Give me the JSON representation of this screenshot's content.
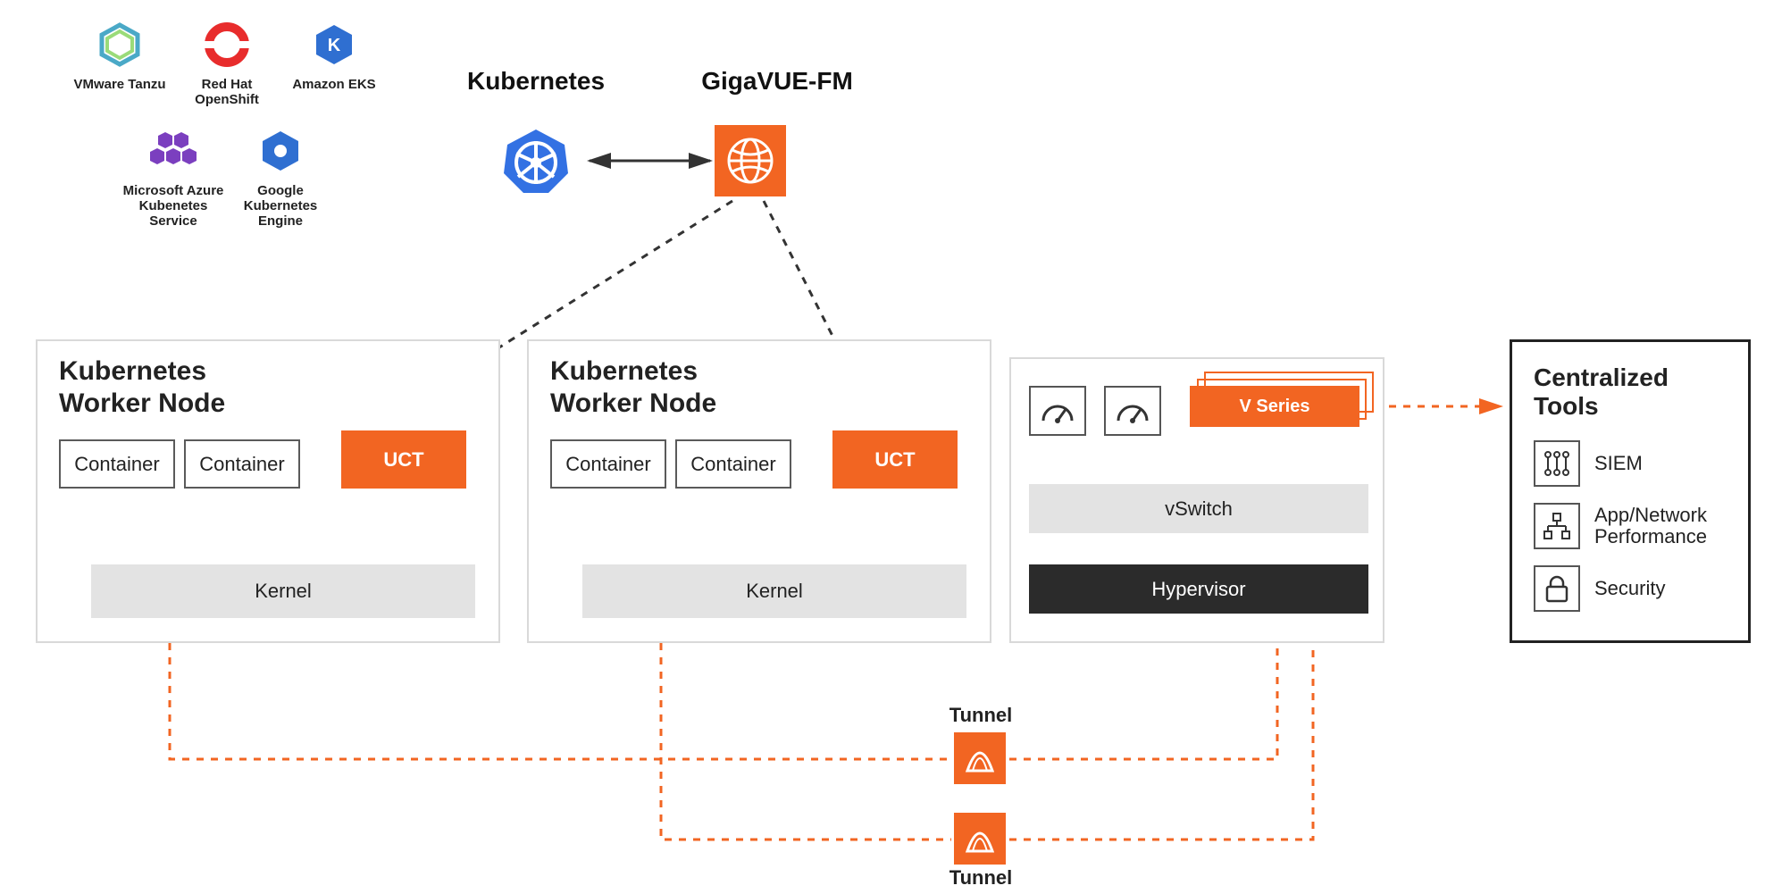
{
  "providers": [
    {
      "name": "VMware\nTanzu",
      "icon": "tanzu-icon",
      "color": "#5fb0c9"
    },
    {
      "name": "Red Hat\nOpenShift",
      "icon": "openshift-icon",
      "color": "#e82c2c"
    },
    {
      "name": "Amazon\nEKS",
      "icon": "eks-icon",
      "color": "#2f6fd1"
    },
    {
      "name": "Microsoft Azure\nKubenetes\nService",
      "icon": "aks-icon",
      "color": "#7b3fbf"
    },
    {
      "name": "Google\nKubernetes\nEngine",
      "icon": "gke-icon",
      "color": "#2f6fd1"
    }
  ],
  "header": {
    "k8s_label": "Kubernetes",
    "fm_label": "GigaVUE-FM"
  },
  "worker_node": {
    "title": "Kubernetes\nWorker Node",
    "container_label": "Container",
    "uct_label": "UCT",
    "kernel_label": "Kernel"
  },
  "vseries_panel": {
    "vseries_label": "V Series",
    "vswitch_label": "vSwitch",
    "hypervisor_label": "Hypervisor"
  },
  "centralized_tools": {
    "title": "Centralized Tools",
    "items": [
      {
        "label": "SIEM",
        "icon": "siem-icon"
      },
      {
        "label": "App/Network\nPerformance",
        "icon": "perf-icon"
      },
      {
        "label": "Security",
        "icon": "lock-icon"
      }
    ]
  },
  "tunnel_label": "Tunnel",
  "colors": {
    "orange": "#f26522",
    "gray_panel": "#d9d9d9",
    "dark": "#2b2b2b"
  }
}
